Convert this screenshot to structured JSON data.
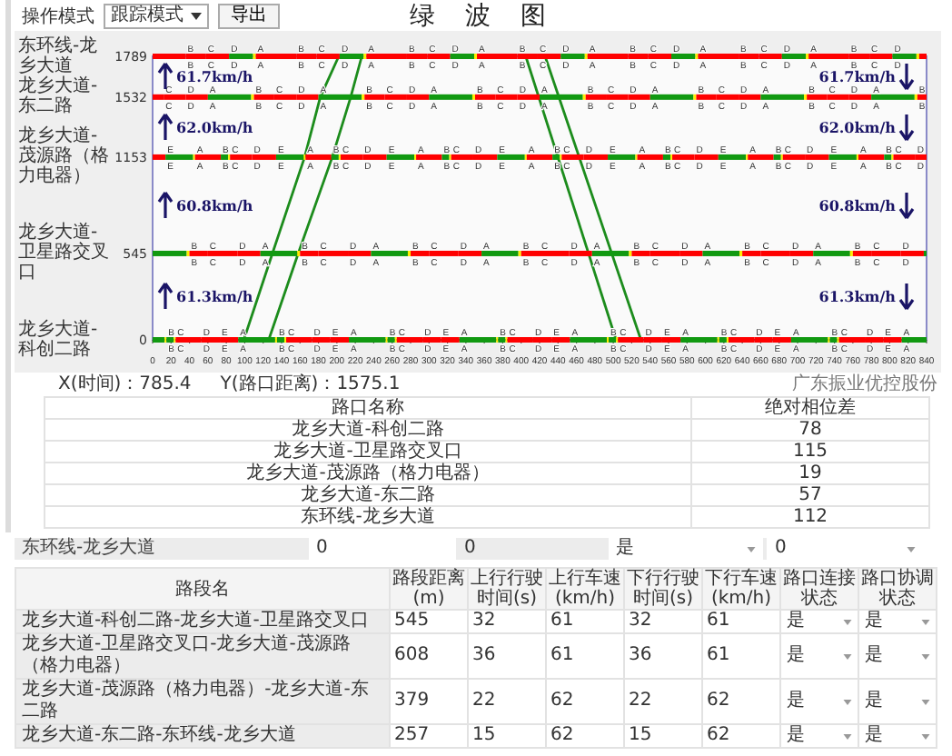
{
  "toolbar": {
    "mode_label": "操作模式",
    "mode_value": "跟踪模式",
    "export": "导出",
    "title": "绿 波 图"
  },
  "chart_data": {
    "type": "line",
    "xlim": [
      0,
      840
    ],
    "ylim": [
      0,
      1789
    ],
    "xticks": [
      0,
      20,
      40,
      60,
      80,
      100,
      120,
      140,
      160,
      180,
      200,
      220,
      240,
      260,
      280,
      300,
      320,
      340,
      360,
      380,
      400,
      420,
      440,
      460,
      480,
      500,
      520,
      540,
      560,
      580,
      600,
      620,
      640,
      660,
      680,
      700,
      720,
      740,
      760,
      780,
      800,
      820,
      840
    ],
    "yticks": [
      {
        "value": 1789,
        "label": "1789"
      },
      {
        "value": 1532,
        "label": "1532"
      },
      {
        "value": 1153,
        "label": "1153"
      },
      {
        "value": 545,
        "label": "545"
      },
      {
        "value": 0,
        "label": "0"
      }
    ],
    "series": [
      {
        "color": "#1c8c1c",
        "x": [
          99,
          130,
          165,
          182,
          202
        ],
        "values": [
          0,
          545,
          1153,
          1532,
          1789
        ]
      },
      {
        "color": "#1c8c1c",
        "x": [
          126,
          158,
          195,
          215,
          227
        ],
        "values": [
          0,
          545,
          1153,
          1532,
          1789
        ]
      },
      {
        "color": "#1c8c1c",
        "x": [
          405,
          503
        ],
        "values": [
          1789,
          0
        ]
      },
      {
        "color": "#1c8c1c",
        "x": [
          426,
          530
        ],
        "values": [
          1789,
          0
        ]
      }
    ],
    "annotations": [
      "61.7km/h",
      "62.0km/h",
      "60.8km/h",
      "61.3km/h",
      "61.7km/h",
      "62.0km/h",
      "60.8km/h",
      "61.3km/h"
    ]
  },
  "intersections": [
    {
      "name": "东环线-龙乡大道",
      "upper_labels": [
        "B",
        "C",
        "D",
        "A",
        "B",
        "C",
        "D",
        "A",
        "B",
        "C",
        "D",
        "A",
        "B",
        "C",
        "D",
        "A",
        "B",
        "C",
        "D",
        "A",
        "B",
        "C",
        "D",
        "A",
        "B",
        "C",
        "D"
      ],
      "lower_labels": [
        "B",
        "C",
        "D",
        "A",
        "B",
        "C",
        "D",
        "A",
        "B",
        "C",
        "D",
        "A",
        "B",
        "C",
        "D",
        "A",
        "B",
        "C",
        "D",
        "A",
        "B",
        "C",
        "D",
        "A",
        "B",
        "C",
        "D"
      ]
    },
    {
      "name": "龙乡大道-东二路",
      "upper_labels": [
        "C",
        "D",
        "A",
        "B",
        "C",
        "D",
        "A",
        "B",
        "C",
        "D",
        "A",
        "B",
        "C",
        "D",
        "A",
        "B",
        "C",
        "D",
        "A",
        "B",
        "C",
        "D",
        "A",
        "B",
        "C",
        "D",
        "A",
        "B"
      ],
      "lower_labels": [
        "C",
        "D",
        "A",
        "B",
        "C",
        "D",
        "A",
        "B",
        "C",
        "D",
        "A",
        "B",
        "C",
        "D",
        "A",
        "B",
        "C",
        "D",
        "A",
        "B",
        "C",
        "D",
        "A",
        "B",
        "C",
        "D",
        "A",
        "B"
      ]
    },
    {
      "name": "龙乡大道-茂源路（格力电器）",
      "upper_labels": [
        "E",
        "A",
        "B",
        "C",
        "D",
        "E",
        "A",
        "B",
        "C",
        "D",
        "E",
        "A",
        "B",
        "C",
        "D",
        "E",
        "A",
        "B",
        "C",
        "D",
        "E",
        "A",
        "B",
        "C",
        "D",
        "E",
        "A",
        "B",
        "C",
        "D",
        "E",
        "A",
        "B",
        "C",
        "D"
      ],
      "lower_labels": [
        "E",
        "A",
        "B",
        "C",
        "D",
        "E",
        "A",
        "B",
        "C",
        "D",
        "E",
        "A",
        "B",
        "C",
        "D",
        "E",
        "A",
        "B",
        "C",
        "D",
        "E",
        "A",
        "B",
        "C",
        "D",
        "E",
        "A",
        "B",
        "C",
        "D",
        "E",
        "A",
        "B",
        "C",
        "D"
      ]
    },
    {
      "name": "龙乡大道-卫星路交叉口",
      "upper_labels": [
        "B",
        "C",
        "D",
        "A",
        "B",
        "C",
        "D",
        "A",
        "B",
        "C",
        "D",
        "A",
        "B",
        "C",
        "D",
        "A",
        "B",
        "C",
        "D",
        "A",
        "B",
        "C",
        "D",
        "A",
        "B",
        "C",
        "D"
      ],
      "lower_labels": [
        "B",
        "C",
        "D",
        "A",
        "B",
        "C",
        "D",
        "A",
        "B",
        "C",
        "D",
        "A",
        "B",
        "C",
        "D",
        "A",
        "B",
        "C",
        "D",
        "A",
        "B",
        "C",
        "D",
        "A",
        "B",
        "C",
        "D"
      ]
    },
    {
      "name": "龙乡大道-科创二路",
      "upper_labels": [
        "B",
        "C",
        "D",
        "E",
        "A",
        "B",
        "C",
        "D",
        "E",
        "A",
        "B",
        "C",
        "D",
        "E",
        "A",
        "B",
        "C",
        "D",
        "E",
        "A",
        "B",
        "C",
        "D",
        "E",
        "A",
        "B",
        "C",
        "D",
        "E",
        "A",
        "B",
        "C",
        "D",
        "E",
        "A"
      ],
      "lower_labels": [
        "B",
        "C",
        "D",
        "E",
        "A",
        "B",
        "C",
        "D",
        "E",
        "A",
        "B",
        "C",
        "D",
        "E",
        "A",
        "B",
        "C",
        "D",
        "E",
        "A",
        "B",
        "C",
        "D",
        "E",
        "A",
        "B",
        "C",
        "D",
        "E",
        "A",
        "B",
        "C",
        "D",
        "E",
        "A"
      ]
    }
  ],
  "coords": {
    "x": "X(时间)：785.4",
    "y": "Y(路口距离)：1575.1",
    "credit": "广东振业优控股份"
  },
  "phase_table": {
    "columns": [
      "路口名称",
      "绝对相位差"
    ],
    "rows": [
      [
        "龙乡大道-科创二路",
        "78"
      ],
      [
        "龙乡大道-卫星路交叉口",
        "115"
      ],
      [
        "龙乡大道-茂源路（格力电器）",
        "19"
      ],
      [
        "龙乡大道-东二路",
        "57"
      ],
      [
        "东环线-龙乡大道",
        "112"
      ]
    ]
  },
  "partial_row": {
    "name": "东环线-龙乡大道",
    "cells": [
      {
        "kind": "input",
        "value": "0"
      },
      {
        "kind": "text",
        "value": "0"
      },
      {
        "kind": "select",
        "value": "是"
      },
      {
        "kind": "select",
        "value": "0"
      }
    ]
  },
  "segment_table": {
    "columns": [
      "路段名",
      "路段距离(m)",
      "上行行驶时间(s)",
      "上行车速(km/h)",
      "下行行驶时间(s)",
      "下行车速(km/h)",
      "路口连接状态",
      "路口协调状态"
    ],
    "rows": [
      [
        "龙乡大道-科创二路-龙乡大道-卫星路交叉口",
        "545",
        "32",
        "61",
        "32",
        "61",
        "是",
        "是"
      ],
      [
        "龙乡大道-卫星路交叉口-龙乡大道-茂源路（格力电器）",
        "608",
        "36",
        "61",
        "36",
        "61",
        "是",
        "是"
      ],
      [
        "龙乡大道-茂源路（格力电器）-龙乡大道-东二路",
        "379",
        "22",
        "62",
        "22",
        "62",
        "是",
        "是"
      ],
      [
        "龙乡大道-东二路-东环线-龙乡大道",
        "257",
        "15",
        "62",
        "15",
        "62",
        "是",
        "是"
      ]
    ]
  }
}
